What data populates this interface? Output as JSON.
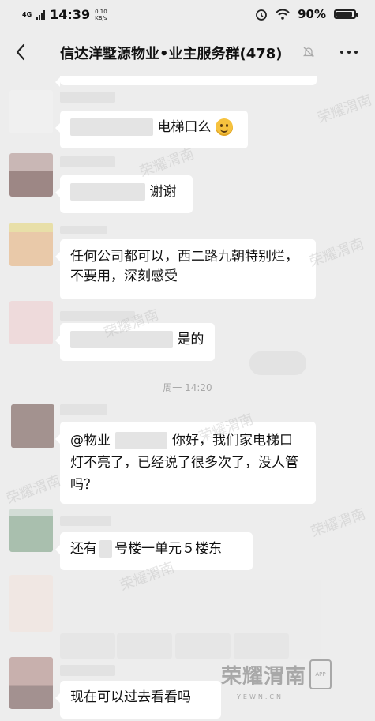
{
  "status_bar": {
    "network": "4G",
    "time": "14:39",
    "speed_value": "0.10",
    "speed_unit": "KB/s",
    "battery_pct": "90%",
    "battery_level": 0.9
  },
  "header": {
    "title": "信达洋墅源物业•业主服务群(478)"
  },
  "messages": [
    {
      "text": "电梯口么"
    },
    {
      "text": "谢谢"
    },
    {
      "text": "任何公司都可以，西二路九朝特别烂，不要用，深刻感受"
    },
    {
      "text": "是的"
    },
    {
      "text_prefix": "@物业",
      "text": "你好，我们家电梯口灯不亮了，已经说了很多次了，没人管吗？"
    },
    {
      "text_prefix": "还有",
      "text": "号楼一单元５楼东"
    },
    {
      "text": "现在可以过去看看吗"
    }
  ],
  "timestamp": "周一 14:20",
  "watermark": {
    "logo_text": "荣耀渭南",
    "logo_box": "APP",
    "url": "YEWN.CN"
  },
  "colors": {
    "background": "#ededed",
    "bubble": "#ffffff"
  }
}
